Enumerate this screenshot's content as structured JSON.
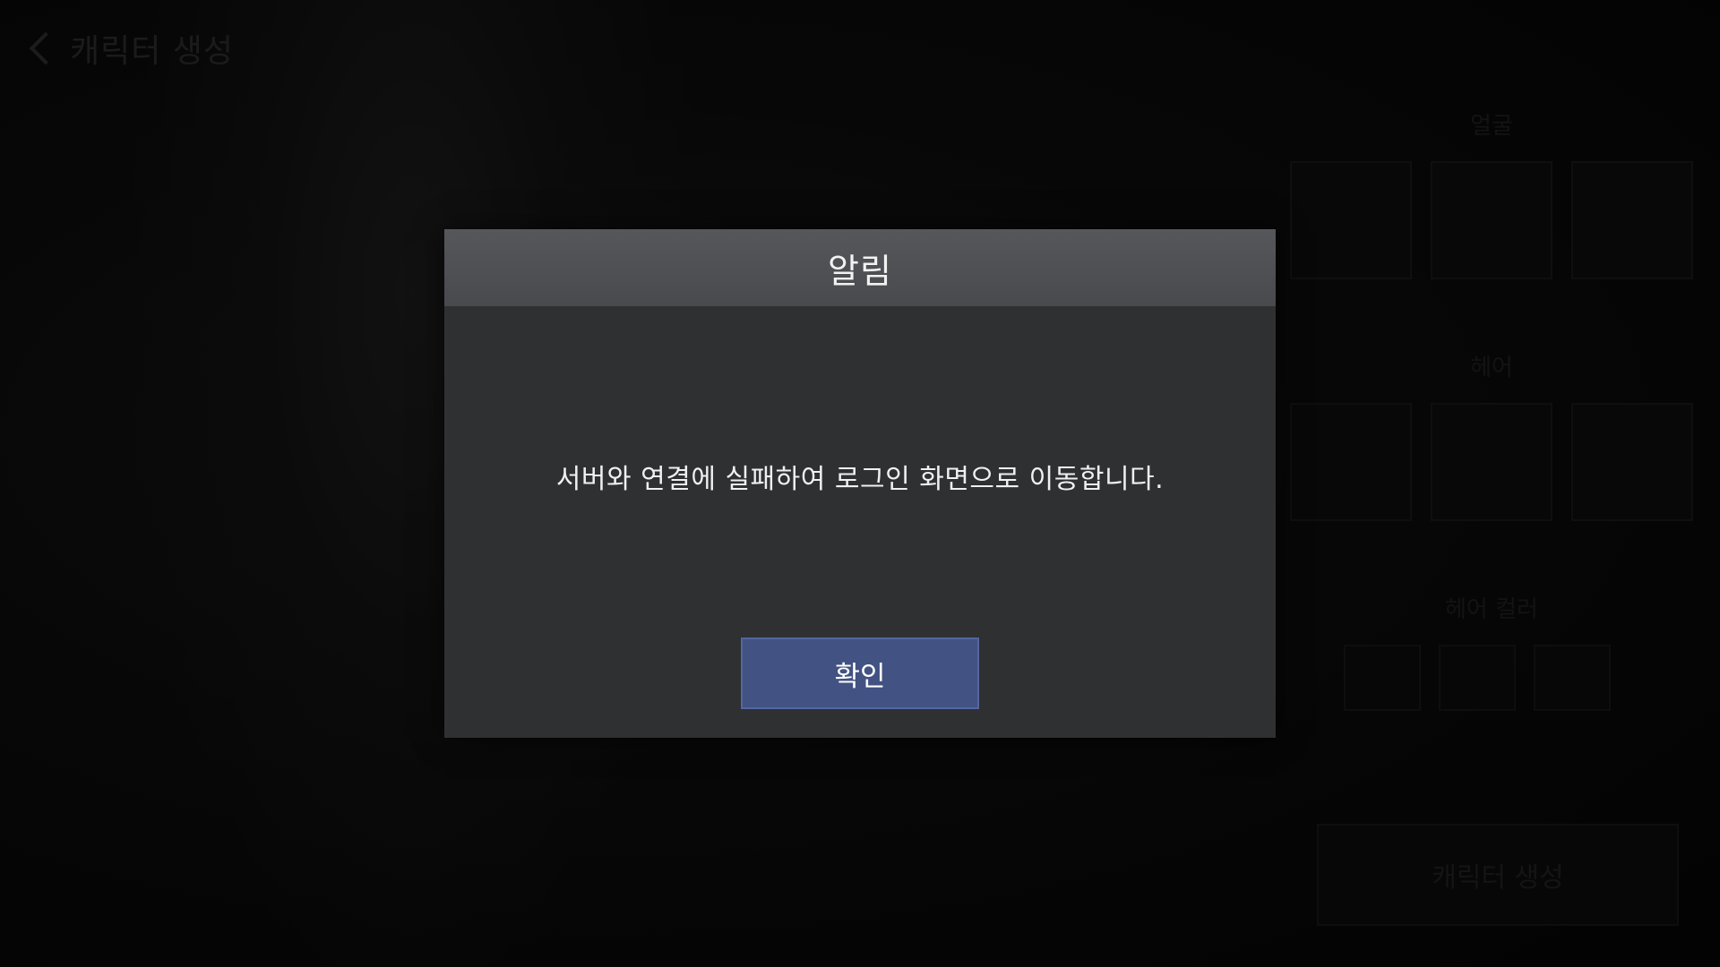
{
  "background": {
    "back_title": "캐릭터 생성",
    "side_panel": {
      "section_1": "얼굴",
      "section_2": "헤어",
      "section_3": "헤어 컬러",
      "create_button": "캐릭터 생성"
    }
  },
  "dialog": {
    "title": "알림",
    "message": "서버와 연결에 실패하여 로그인 화면으로 이동합니다.",
    "confirm_label": "확인"
  },
  "colors": {
    "dialog_bg": "#2f3032",
    "header_bg": "#505256",
    "confirm_bg": "#415283"
  }
}
